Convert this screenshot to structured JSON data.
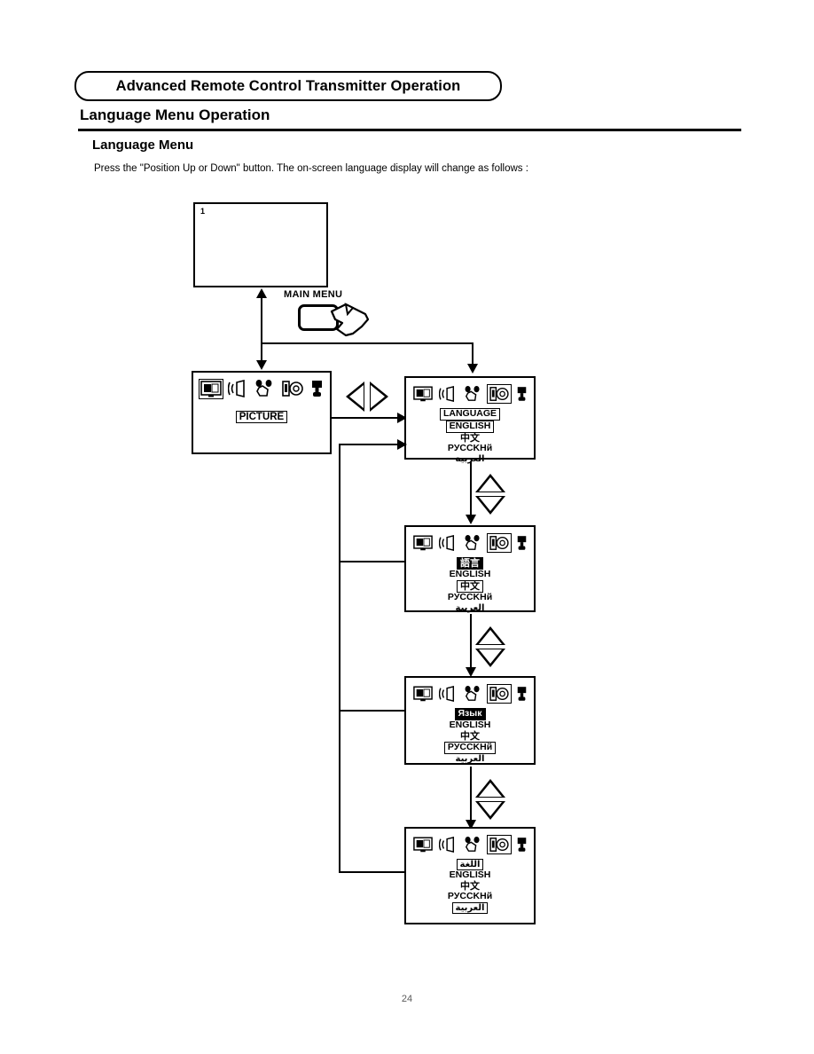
{
  "document": {
    "chapter_heading": "Advanced Remote Control Transmitter Operation",
    "section_heading": "Language Menu Operation",
    "sub_heading": "Language Menu",
    "instruction": "Press the \"Position Up or Down\" button. The on-screen language display will change as follows :",
    "page_number": "24"
  },
  "remote": {
    "main_menu_label": "MAIN MENU",
    "button_name": "main-menu-button",
    "hand_icon": "pointing-hand-icon"
  },
  "keys": {
    "up_down_name": "position-up-down-key",
    "left_right_name": "position-left-right-key"
  },
  "icons": {
    "picture": "picture-icon",
    "audio": "audio-speaker-icon",
    "remote_hand": "remote-hand-icon",
    "setup": "setup-icon",
    "plug": "plug-icon"
  },
  "screens": {
    "tv": {
      "name": "tv-screen-initial",
      "corner_number": "1"
    },
    "picture_menu": {
      "name": "picture-menu-screen",
      "selected_icon_index": 0,
      "label": "PICTURE"
    },
    "language_english": {
      "name": "language-menu-english",
      "selected_icon_index": 3,
      "title": "LANGUAGE",
      "title_style": "box",
      "items": [
        {
          "text": "ENGLISH",
          "style": "box",
          "script": "latin"
        },
        {
          "text": "中文",
          "style": "plain",
          "script": "cjk"
        },
        {
          "text": "PУCCKНй",
          "style": "plain",
          "script": "latin"
        },
        {
          "text": "العربية",
          "style": "plain",
          "script": "arabic"
        }
      ]
    },
    "language_chinese": {
      "name": "language-menu-chinese",
      "selected_icon_index": 3,
      "title": "語言",
      "title_style": "inv",
      "items": [
        {
          "text": "ENGLISH",
          "style": "plain",
          "script": "latin"
        },
        {
          "text": "中文",
          "style": "box",
          "script": "cjk"
        },
        {
          "text": "PУCCKНй",
          "style": "plain",
          "script": "latin"
        },
        {
          "text": "العربية",
          "style": "plain",
          "script": "arabic"
        }
      ]
    },
    "language_russian": {
      "name": "language-menu-russian",
      "selected_icon_index": 3,
      "title": "Язык",
      "title_style": "inv",
      "items": [
        {
          "text": "ENGLISH",
          "style": "plain",
          "script": "latin"
        },
        {
          "text": "中文",
          "style": "plain",
          "script": "cjk"
        },
        {
          "text": "PУCCKНй",
          "style": "box",
          "script": "latin"
        },
        {
          "text": "العربية",
          "style": "plain",
          "script": "arabic"
        }
      ]
    },
    "language_arabic": {
      "name": "language-menu-arabic",
      "selected_icon_index": 3,
      "title": "اللغة",
      "title_style": "box",
      "items": [
        {
          "text": "ENGLISH",
          "style": "plain",
          "script": "latin"
        },
        {
          "text": "中文",
          "style": "plain",
          "script": "cjk"
        },
        {
          "text": "PУCCKНй",
          "style": "plain",
          "script": "latin"
        },
        {
          "text": "العربية",
          "style": "box",
          "script": "arabic"
        }
      ]
    }
  }
}
